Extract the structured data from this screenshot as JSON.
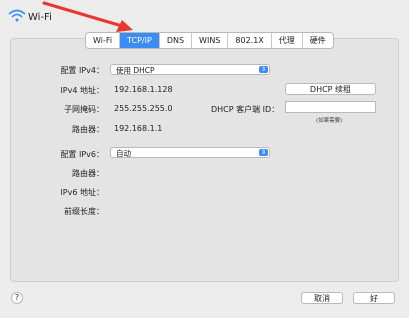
{
  "window": {
    "title": "Wi-Fi",
    "wifi_icon": "wifi-icon",
    "arrow_color": "#e8372c"
  },
  "tabs": [
    {
      "label": "Wi-Fi",
      "active": false
    },
    {
      "label": "TCP/IP",
      "active": true
    },
    {
      "label": "DNS",
      "active": false
    },
    {
      "label": "WINS",
      "active": false
    },
    {
      "label": "802.1X",
      "active": false
    },
    {
      "label": "代理",
      "active": false
    },
    {
      "label": "硬件",
      "active": false
    }
  ],
  "ipv4": {
    "config_label": "配置 IPv4：",
    "config_value": "使用 DHCP",
    "address_label": "IPv4 地址：",
    "address_value": "192.168.1.128",
    "subnet_label": "子网掩码：",
    "subnet_value": "255.255.255.0",
    "router_label": "路由器：",
    "router_value": "192.168.1.1",
    "renew_button": "DHCP 续租",
    "client_id_label": "DHCP 客户端 ID：",
    "client_id_value": "",
    "client_id_hint": "(如果需要)"
  },
  "ipv6": {
    "config_label": "配置 IPv6：",
    "config_value": "自动",
    "router_label": "路由器：",
    "router_value": "",
    "address_label": "IPv6 地址：",
    "address_value": "",
    "prefix_label": "前缀长度：",
    "prefix_value": ""
  },
  "footer": {
    "help": "?",
    "cancel": "取消",
    "ok": "好"
  },
  "colors": {
    "accent": "#3b8cf5",
    "panel": "#e4e4e4",
    "background": "#ececec"
  }
}
